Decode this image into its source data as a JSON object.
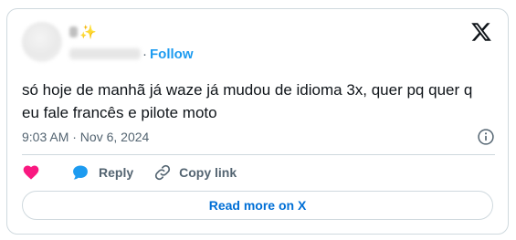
{
  "tweet": {
    "author": {
      "name_suffix": "✨",
      "follow_label": "Follow",
      "separator": "·"
    },
    "text": "só hoje de manhã já waze já mudou de idioma 3x, quer pq quer q eu fale francês e pilote moto",
    "timestamp": "9:03 AM · Nov 6, 2024",
    "actions": {
      "reply_label": "Reply",
      "copy_link_label": "Copy link"
    },
    "read_more_label": "Read more on X"
  },
  "colors": {
    "accent": "#1d9bf0",
    "like": "#f91880",
    "reply": "#1d9bf0",
    "text": "#0f1419",
    "muted": "#536471",
    "border": "#cfd9de"
  },
  "icons": [
    "x-logo-icon",
    "info-icon",
    "heart-icon",
    "chat-bubble-icon",
    "link-icon"
  ]
}
